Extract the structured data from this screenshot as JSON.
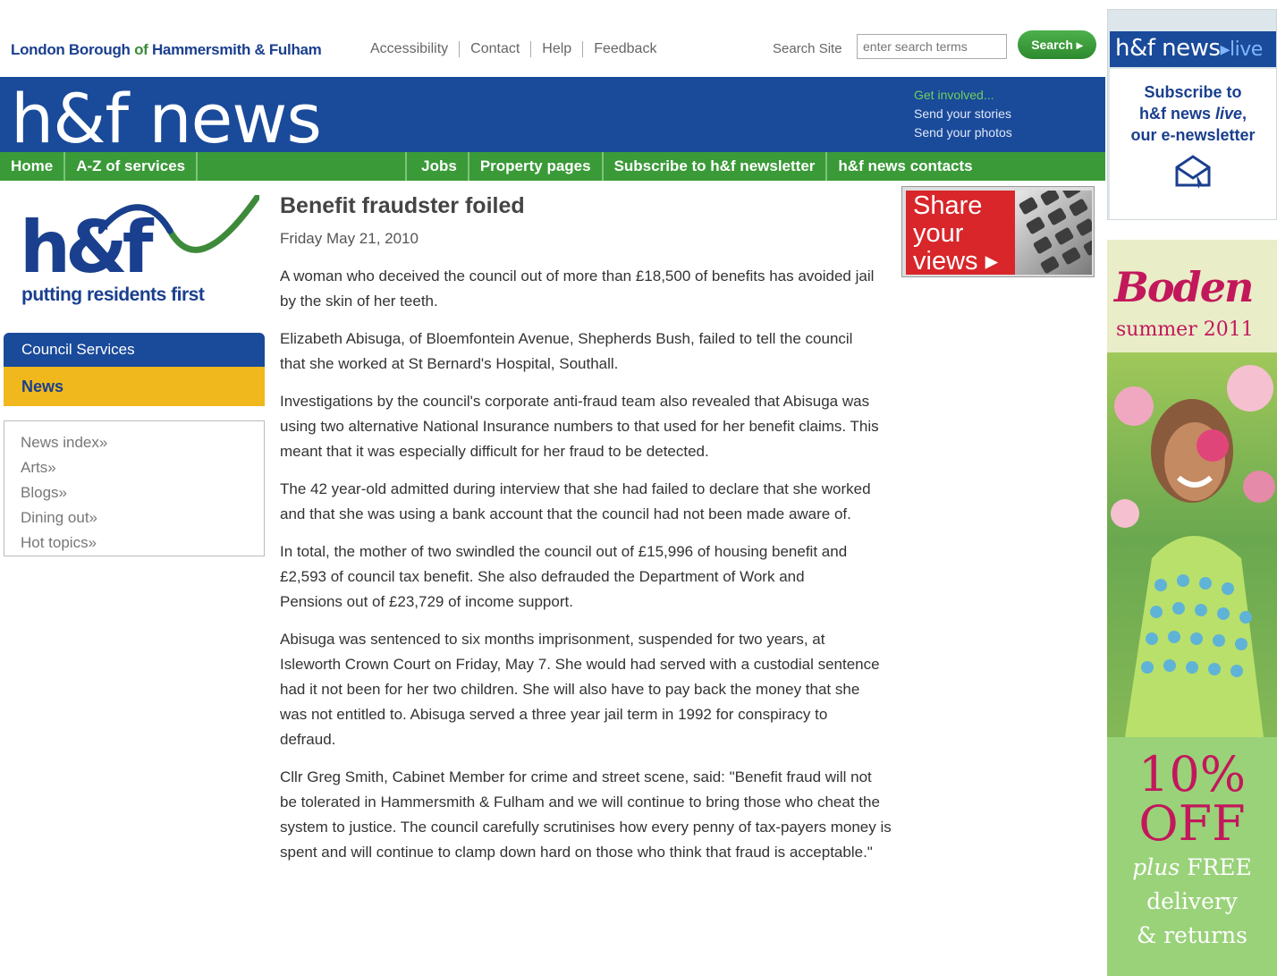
{
  "header": {
    "borough_prefix": "London Borough",
    "borough_of": " of ",
    "borough_suffix": "Hammersmith & Fulham",
    "utility_links": [
      "Accessibility",
      "Contact",
      "Help",
      "Feedback"
    ],
    "search_label": "Search Site",
    "search_placeholder": "enter search terms",
    "search_button": "Search ▸"
  },
  "masthead": {
    "title": "h&f news",
    "get_involved_title": "Get involved...",
    "get_involved_links": [
      "Send your stories",
      "Send your photos"
    ]
  },
  "nav": {
    "items": [
      "Home",
      "A-Z of services",
      "Jobs",
      "Property pages",
      "Subscribe to h&f newsletter",
      "h&f news contacts"
    ]
  },
  "sidebar": {
    "logo_text": "h&f",
    "tagline": "putting residents first",
    "section": "Council Services",
    "current": "News",
    "links": [
      "News index»",
      "Arts»",
      "Blogs»",
      "Dining out»",
      "Hot topics»"
    ]
  },
  "article": {
    "title": "Benefit fraudster foiled",
    "date": "Friday May 21, 2010",
    "paragraphs": [
      "A woman who deceived the council out of more than £18,500 of benefits has avoided jail by the skin of her teeth.",
      "Elizabeth Abisuga, of Bloemfontein Avenue, Shepherds Bush, failed to tell the council that she worked at St Bernard's Hospital, Southall.",
      "Investigations by the council's corporate anti-fraud team also revealed that Abisuga was using two alternative National Insurance numbers to that used for her benefit claims. This meant that it was especially difficult for her fraud to be detected.",
      "The 42 year-old admitted during interview that she had failed to declare that she worked and that she was using a bank account that the council had not been made aware of.",
      "In total, the mother of two swindled the council out of £15,996 of housing benefit and £2,593 of council tax benefit. She also defrauded the Department of Work and Pensions out of £23,729 of income support.",
      "Abisuga was sentenced to six months imprisonment, suspended for two years, at Isleworth Crown Court on Friday, May 7. She would had served with a custodial sentence had it not been for her two children. She will also have to pay back the money that she was not entitled to. Abisuga served a three year jail term in 1992 for conspiracy to defraud.",
      "Cllr Greg Smith, Cabinet Member for crime and street scene, said: \"Benefit fraud will not be tolerated in Hammersmith & Fulham and we will continue to bring those who cheat the system to justice. The council carefully scrutinises how every penny of tax-payers money is spent and will continue to clamp down hard on those who think that fraud is acceptable.\""
    ]
  },
  "share": {
    "line1": "Share",
    "line2": "your",
    "line3": "views ▸"
  },
  "live_ad": {
    "brand": "h&f news",
    "brand_suffix": "▸live",
    "line1": "Subscribe to",
    "line2_prefix": "h&f news ",
    "line2_live": "live",
    "line2_comma": ",",
    "line3": "our e-newsletter"
  },
  "boden_ad": {
    "brand": "Boden",
    "season": "summer 2011",
    "discount": "10%",
    "off": "OFF",
    "plus": "plus",
    "free": " FREE",
    "delivery": "delivery",
    "returns": "& returns"
  },
  "colors": {
    "brand_blue": "#1a4a9a",
    "brand_green": "#3a9a38",
    "news_yellow": "#f0b81c",
    "share_red": "#d8262a",
    "boden_pink": "#c2185b"
  }
}
